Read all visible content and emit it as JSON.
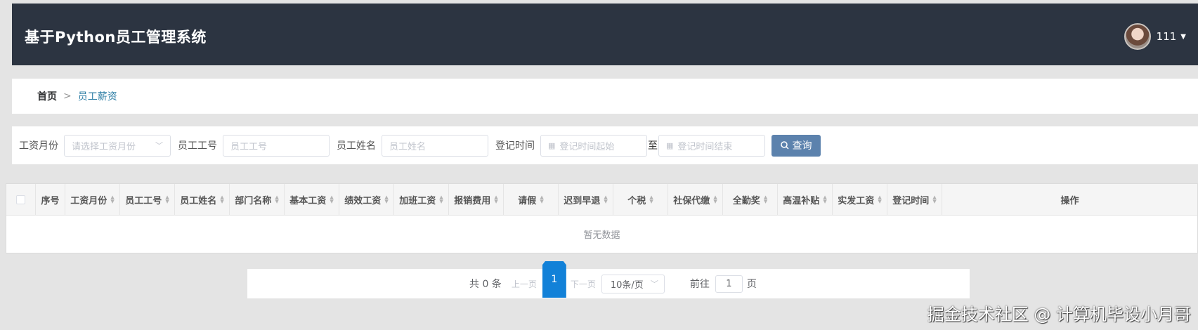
{
  "app": {
    "title": "基于Python员工管理系统"
  },
  "user": {
    "name": "111"
  },
  "breadcrumb": {
    "home": "首页",
    "separator": ">",
    "current": "员工薪资"
  },
  "filters": {
    "month_label": "工资月份",
    "month_placeholder": "请选择工资月份",
    "emp_no_label": "员工工号",
    "emp_no_placeholder": "员工工号",
    "emp_name_label": "员工姓名",
    "emp_name_placeholder": "员工姓名",
    "time_label": "登记时间",
    "time_start_placeholder": "登记时间起始",
    "time_to": "至",
    "time_end_placeholder": "登记时间结束",
    "search_label": "查询"
  },
  "table": {
    "columns": [
      "序号",
      "工资月份",
      "员工工号",
      "员工姓名",
      "部门名称",
      "基本工资",
      "绩效工资",
      "加班工资",
      "报销费用",
      "请假",
      "迟到早退",
      "个税",
      "社保代缴",
      "全勤奖",
      "高温补贴",
      "实发工资",
      "登记时间",
      "操作"
    ],
    "empty_text": "暂无数据"
  },
  "pagination": {
    "total": "共 0 条",
    "prev": "上一页",
    "current": "1",
    "next": "下一页",
    "page_size": "10条/页",
    "goto_label": "前往",
    "goto_value": "1",
    "page_unit": "页"
  },
  "watermark": "掘金技术社区 @ 计算机毕设小月哥"
}
